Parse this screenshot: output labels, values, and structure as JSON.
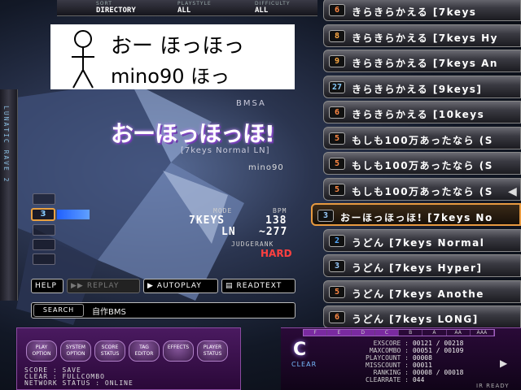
{
  "header": {
    "sort_label": "SORT",
    "sort_value": "DIRECTORY",
    "playstyle_label": "PLAYSTYLE",
    "playstyle_value": "ALL",
    "difficulty_label": "DIFFICULTY",
    "difficulty_value": "ALL"
  },
  "banner": {
    "line1": "おー ほっほっ",
    "line2": "mino90 ほっ"
  },
  "left_strip_text": "LUNATIC RAVE 2",
  "song": {
    "genre": "BMSA",
    "title": "おーほっほっほ!",
    "subtitle": "[7keys Normal LN]",
    "artist": "mino90",
    "level": "3"
  },
  "stats": {
    "mode_label": "MODE",
    "mode_value": "7KEYS",
    "bpm_label": "BPM",
    "bpm_value": "138",
    "ln_label": "LN",
    "ln_value": "~277",
    "judgerank_label": "JUDGERANK",
    "judgerank_value": "HARD"
  },
  "buttons": {
    "help": "HELP",
    "replay": "REPLAY",
    "autoplay": "AUTOPLAY",
    "readtext": "READTEXT"
  },
  "search": {
    "label": "SEARCH",
    "value": "自作BMS"
  },
  "songlist": [
    {
      "level": "6",
      "title": "きらきらかえる [7keys",
      "selected": false
    },
    {
      "level": "8",
      "title": "きらきらかえる [7keys Hy",
      "selected": false
    },
    {
      "level": "9",
      "title": "きらきらかえる [7keys An",
      "selected": false
    },
    {
      "level": "27",
      "title": "きらきらかえる [9keys]",
      "selected": false
    },
    {
      "level": "6",
      "title": "きらきらかえる [10keys",
      "selected": false
    },
    {
      "level": "5",
      "title": "もしも100万あったなら (S",
      "selected": false
    },
    {
      "level": "5",
      "title": "もしも100万あったなら (S",
      "selected": false
    },
    {
      "level": "5",
      "title": "もしも100万あったなら (S",
      "selected": false
    },
    {
      "level": "3",
      "title": "おーほっほっほ! [7keys No",
      "selected": true
    },
    {
      "level": "2",
      "title": "うどん [7keys Normal",
      "selected": false
    },
    {
      "level": "3",
      "title": "うどん [7keys Hyper]",
      "selected": false
    },
    {
      "level": "5",
      "title": "うどん [7keys Anothe",
      "selected": false
    },
    {
      "level": "6",
      "title": "うどん [7keys LONG]",
      "selected": false
    }
  ],
  "options": [
    {
      "l1": "PLAY",
      "l2": "OPTION"
    },
    {
      "l1": "SYSTEM",
      "l2": "OPTION"
    },
    {
      "l1": "SCORE",
      "l2": "STATUS"
    },
    {
      "l1": "TAG",
      "l2": "EDITOR"
    },
    {
      "l1": "EFFECTS",
      "l2": ""
    },
    {
      "l1": "PLAYER",
      "l2": "STATUS"
    }
  ],
  "status": {
    "score": "SCORE : SAVE",
    "clear": "CLEAR : FULLCOMBO",
    "network": "NETWORK STATUS : ONLINE"
  },
  "grades": [
    "F",
    "E",
    "D",
    "C",
    "B",
    "A",
    "AA",
    "AAA"
  ],
  "grade_hits": 4,
  "result": {
    "grade": "C",
    "clear_label": "CLEAR",
    "exscore_label": "EXSCORE :",
    "exscore_value": "00121 / 00218",
    "maxcombo_label": "MAXCOMBO :",
    "maxcombo_value": "00051 / 00109",
    "playcount_label": "PLAYCOUNT :",
    "playcount_value": "00008",
    "misscount_label": "MISSCOUNT :",
    "misscount_value": "00011",
    "ranking_label": "RANKING :",
    "ranking_value": "00008 / 00018",
    "clearrate_label": "CLEARRATE :",
    "clearrate_value": "044"
  },
  "ir_status": "IR READY",
  "colors": {
    "accent": "#e89a40",
    "purple": "#7a2aa0",
    "rank_red": "#ff4040"
  }
}
